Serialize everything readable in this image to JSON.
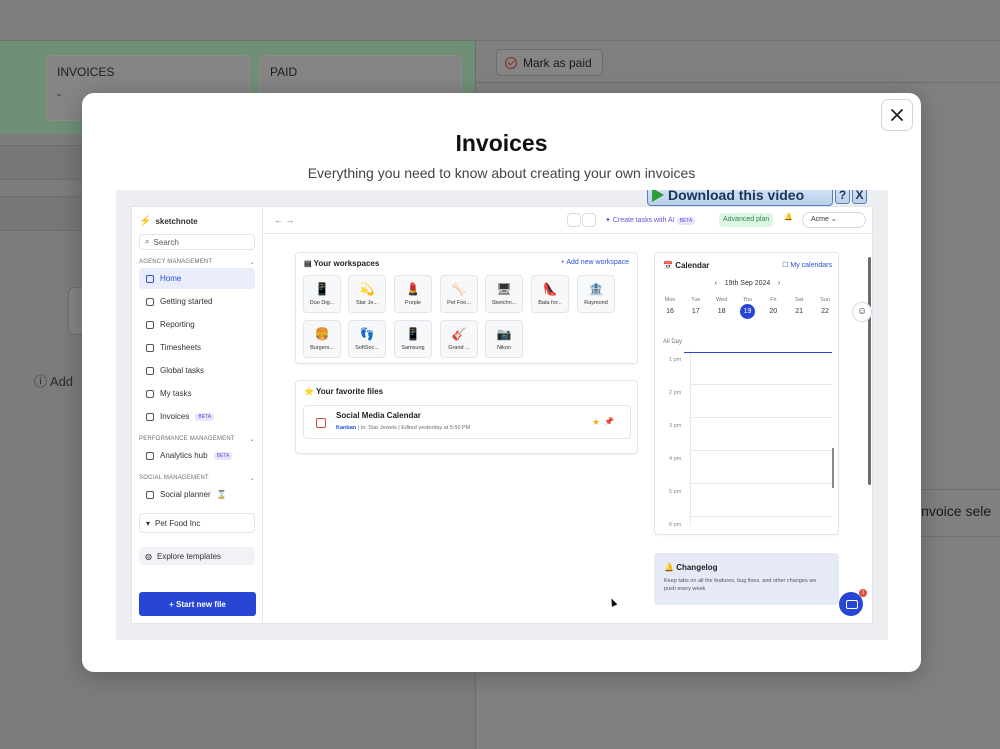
{
  "background": {
    "cards": [
      {
        "title": "INVOICES",
        "value": "-"
      },
      {
        "title": "PAID",
        "value": ""
      }
    ],
    "mark_as_paid": "Mark as paid",
    "add_label": "Add",
    "invoice_select": "invoice sele"
  },
  "modal": {
    "title": "Invoices",
    "subtitle": "Everything you need to know about creating your own invoices",
    "close_icon": "close-icon"
  },
  "video": {
    "download_label": "Download this video",
    "help_label": "?",
    "close_label": "X",
    "sidebar": {
      "brand": "sketchnote",
      "search": "Search",
      "sections": [
        {
          "label": "AGENCY MANAGEMENT"
        },
        {
          "label": "PERFORMANCE MANAGEMENT"
        },
        {
          "label": "SOCIAL MANAGEMENT"
        }
      ],
      "items": [
        {
          "label": "Home"
        },
        {
          "label": "Getting started"
        },
        {
          "label": "Reporting"
        },
        {
          "label": "Timesheets"
        },
        {
          "label": "Global tasks"
        },
        {
          "label": "My tasks"
        },
        {
          "label": "Invoices",
          "badge": "BETA"
        },
        {
          "label": "Analytics hub",
          "badge": "BETA"
        },
        {
          "label": "Social planner"
        }
      ],
      "workspace": "Pet Food Inc",
      "explore": "Explore templates",
      "start": "+ Start new file"
    },
    "header": {
      "create_tasks": "Create tasks with AI",
      "create_badge": "BETA",
      "plan": "Advanced plan",
      "account": "Acme"
    },
    "workspaces": {
      "title": "Your workspaces",
      "add": "+ Add new workspace",
      "tiles": [
        {
          "label": "Duo Dig...",
          "emoji": "📱"
        },
        {
          "label": "Star Je...",
          "emoji": "💫"
        },
        {
          "label": "Purple",
          "emoji": "💄"
        },
        {
          "label": "Pet Foo...",
          "emoji": "🦴"
        },
        {
          "label": "Sketchn...",
          "emoji": "🖥"
        },
        {
          "label": "Bata for...",
          "emoji": "👠"
        },
        {
          "label": "Raymond",
          "emoji": "🏦"
        },
        {
          "label": "Burgers...",
          "emoji": "🍔"
        },
        {
          "label": "SoftSoc...",
          "emoji": "👣"
        },
        {
          "label": "Samsung",
          "emoji": "📱"
        },
        {
          "label": "Grand ...",
          "emoji": "🎸"
        },
        {
          "label": "Nikon",
          "emoji": "📷"
        }
      ]
    },
    "favorites": {
      "title": "Your favorite files",
      "file_name": "Social Media Calendar",
      "file_kind": "Kanban",
      "file_meta": "| In: Star Jewels | Edited yesterday at 5:50 PM"
    },
    "calendar": {
      "title": "Calendar",
      "my_calendars": "My calendars",
      "date": "19th Sep 2024",
      "days": [
        "Mon",
        "Tue",
        "Wed",
        "Thu",
        "Fri",
        "Sat",
        "Sun"
      ],
      "dates": [
        "16",
        "17",
        "18",
        "19",
        "20",
        "21",
        "22"
      ],
      "all_day": "All Day",
      "hours": [
        "1 pm",
        "2 pm",
        "3 pm",
        "4 pm",
        "5 pm",
        "6 pm"
      ]
    },
    "changelog": {
      "title": "Changelog",
      "text": "Keep tabs on all the features, bug fixes, and other changes we push every week"
    },
    "chat_badge": "1"
  }
}
